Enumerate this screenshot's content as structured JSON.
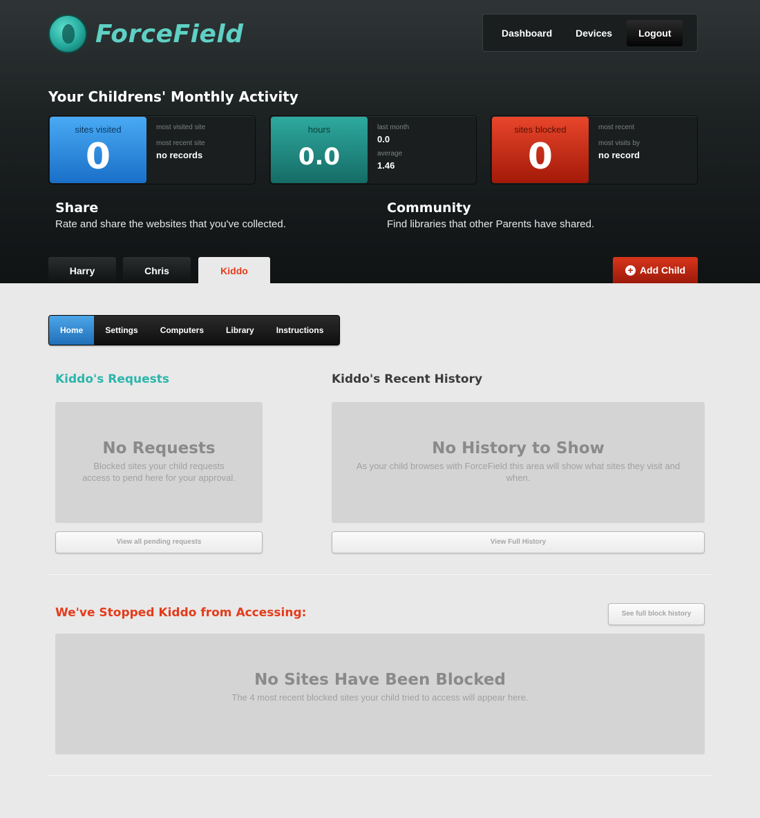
{
  "brand": {
    "name": "ForceField"
  },
  "topnav": {
    "items": [
      "Dashboard",
      "Devices",
      "Logout"
    ]
  },
  "activity": {
    "title": "Your Childrens' Monthly Activity",
    "cards": [
      {
        "label": "sites visited",
        "value": "0",
        "meta": [
          {
            "label": "most visited site",
            "value": ""
          },
          {
            "label": "most recent site",
            "value": "no records"
          }
        ]
      },
      {
        "label": "hours",
        "value": "0.0",
        "meta": [
          {
            "label": "last month",
            "value": "0.0"
          },
          {
            "label": "average",
            "value": "1.46"
          }
        ]
      },
      {
        "label": "sites blocked",
        "value": "0",
        "meta": [
          {
            "label": "most recent",
            "value": ""
          },
          {
            "label": "most visits by",
            "value": "no record"
          }
        ]
      }
    ],
    "colors": {
      "blue": "#1a6fc8",
      "teal": "#156c66",
      "red": "#a31908"
    }
  },
  "share": {
    "title": "Share",
    "text": "Rate and share the websites that you've collected."
  },
  "community": {
    "title": "Community",
    "text": "Find libraries that other Parents have shared."
  },
  "children": {
    "tabs": [
      "Harry",
      "Chris",
      "Kiddo"
    ],
    "active": "Kiddo",
    "add_label": "Add Child"
  },
  "subnav": {
    "items": [
      "Home",
      "Settings",
      "Computers",
      "Library",
      "Instructions"
    ],
    "active": "Home"
  },
  "requests": {
    "title": "Kiddo's Requests",
    "empty_title": "No Requests",
    "empty_text": "Blocked sites your child requests access to pend here for your approval.",
    "button": "View all pending requests"
  },
  "history": {
    "title": "Kiddo's Recent History",
    "empty_title": "No History to Show",
    "empty_text": "As your child browses with ForceField this area will show what sites they visit and when.",
    "button": "View Full History"
  },
  "blocked": {
    "title": "We've Stopped Kiddo from Accessing:",
    "button": "See full block history",
    "empty_title": "No Sites Have Been Blocked",
    "empty_text": "The 4 most recent blocked sites your child tried to access will appear here."
  },
  "accent": {
    "teal": "#2bb5ab",
    "red": "#e43b1b"
  }
}
